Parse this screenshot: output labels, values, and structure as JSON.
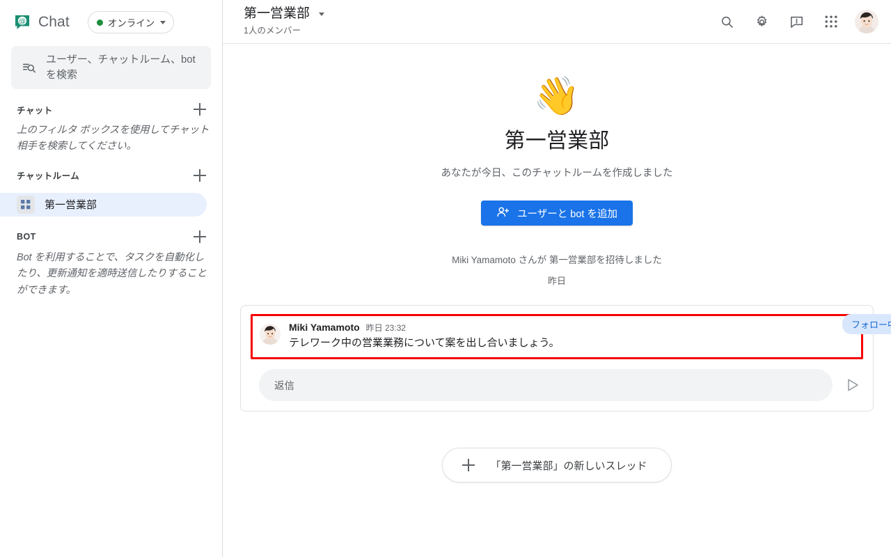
{
  "sidebar": {
    "brand": {
      "name": "Chat",
      "logo_icon": "chat-at-logo",
      "logo_color": "#1a8e72"
    },
    "status": {
      "label": "オンライン",
      "dot_color": "#1e8e3e",
      "caret_icon": "chevron-down-icon"
    },
    "search": {
      "placeholder": "ユーザー、チャットルーム、bot を検索",
      "icon": "search-filter-icon"
    },
    "sections": [
      {
        "title": "チャット",
        "add_icon": "plus-icon",
        "note": "上のフィルタ ボックスを使用してチャット相手を検索してください。"
      },
      {
        "title": "チャットルーム",
        "add_icon": "plus-icon",
        "rooms": [
          {
            "label": "第一営業部",
            "icon": "room-grid-icon",
            "selected": true
          }
        ]
      },
      {
        "title": "BOT",
        "add_icon": "plus-icon",
        "note": "Bot を利用することで、タスクを自動化したり、更新通知を適時送信したりすることができます。"
      }
    ]
  },
  "topbar": {
    "room_title": "第一営業部",
    "room_title_caret": "chevron-down-icon",
    "members": "1人のメンバー",
    "actions": [
      {
        "name": "search-icon",
        "label": "検索"
      },
      {
        "name": "gear-icon",
        "label": "設定"
      },
      {
        "name": "feedback-icon",
        "label": "フィードバック"
      },
      {
        "name": "apps-grid-icon",
        "label": "Google アプリ"
      }
    ],
    "avatar": {
      "name": "account-avatar"
    }
  },
  "welcome": {
    "wave_emoji": "👋",
    "title": "第一営業部",
    "subtitle": "あなたが今日、このチャットルームを作成しました",
    "add_button": {
      "label": "ユーザーと bot を追加",
      "icon": "add-person-icon",
      "color": "#1a73e8"
    },
    "invite_line": "Miki Yamamoto さんが 第一営業部を招待しました",
    "day_label": "昨日"
  },
  "thread": {
    "highlight_color": "#f60000",
    "message": {
      "author": "Miki Yamamoto",
      "time": "昨日 23:32",
      "text": "テレワーク中の営業業務について案を出し合いましょう。",
      "avatar": "message-avatar"
    },
    "follow_badge": {
      "label": "フォロー中",
      "bg": "#d9e7fd",
      "fg": "#1967d2"
    },
    "reply": {
      "placeholder": "返信",
      "send_icon": "send-icon"
    }
  },
  "new_thread": {
    "label": "「第一営業部」の新しいスレッド",
    "icon": "plus-icon"
  }
}
